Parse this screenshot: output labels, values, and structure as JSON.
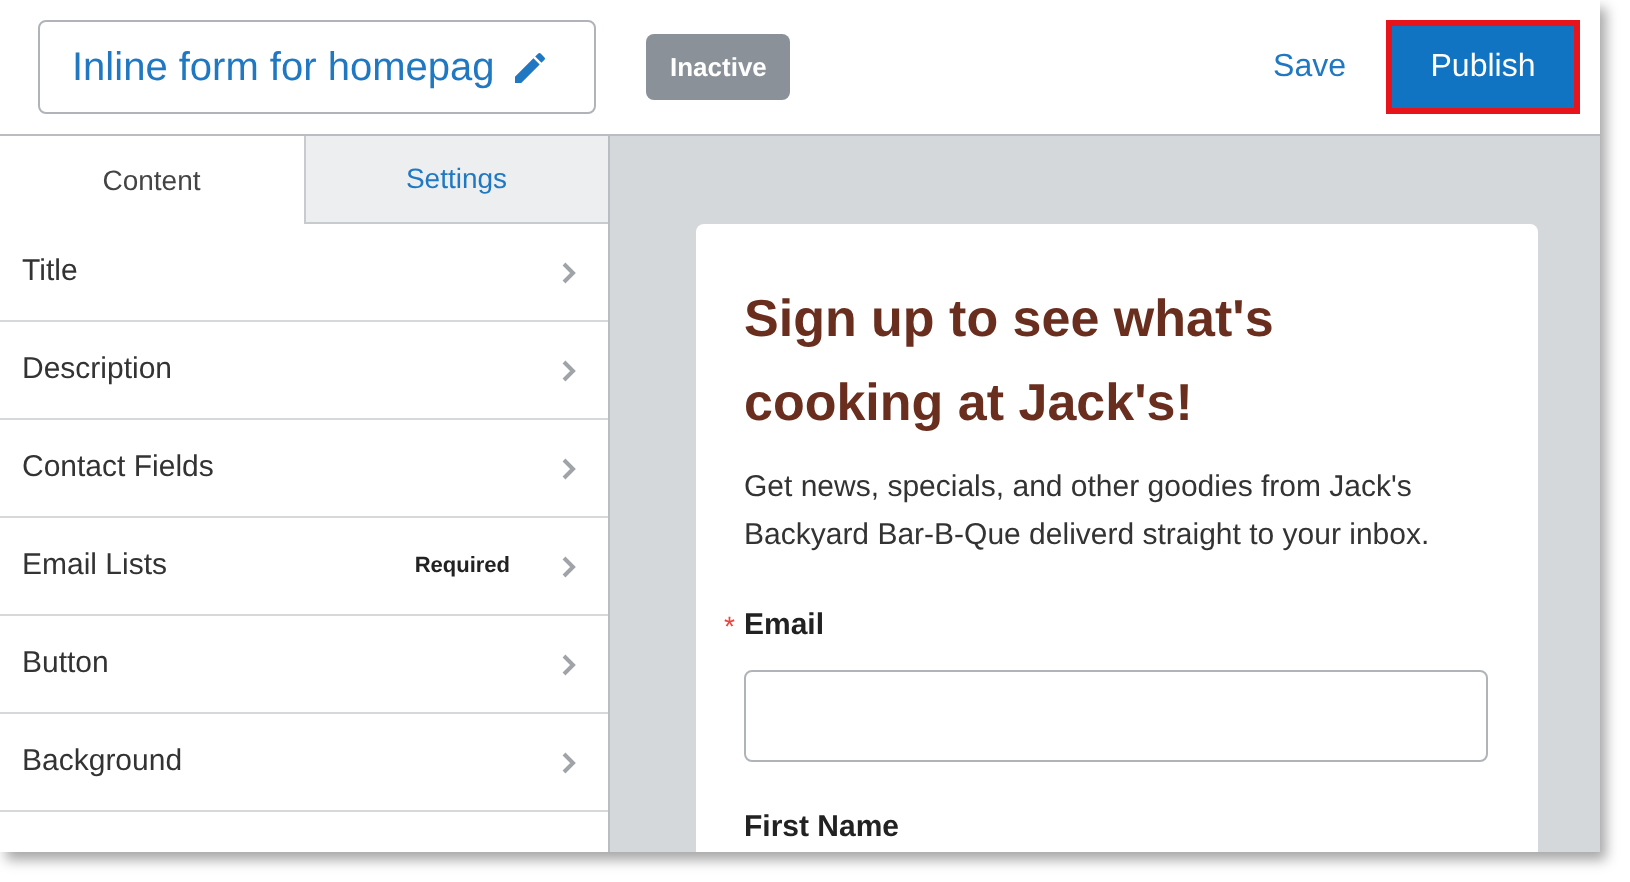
{
  "header": {
    "form_name": "Inline form for homepag",
    "status": "Inactive",
    "save": "Save",
    "publish": {
      "label": "Publish",
      "highlighted": true
    }
  },
  "tabs": [
    {
      "label": "Content",
      "selected": true
    },
    {
      "label": "Settings",
      "selected": false
    }
  ],
  "sections": [
    {
      "label": "Title"
    },
    {
      "label": "Description"
    },
    {
      "label": "Contact Fields"
    },
    {
      "label": "Email Lists",
      "badge": "Required"
    },
    {
      "label": "Button"
    },
    {
      "label": "Background"
    }
  ],
  "preview": {
    "heading": "Sign up to see what's cooking at Jack's!",
    "description": "Get news, specials, and other goodies from Jack's Backyard Bar-B-Que deliverd straight to your inbox.",
    "fields": [
      {
        "label": "Email",
        "asterisk": "*"
      },
      {
        "label": "First Name"
      }
    ]
  }
}
